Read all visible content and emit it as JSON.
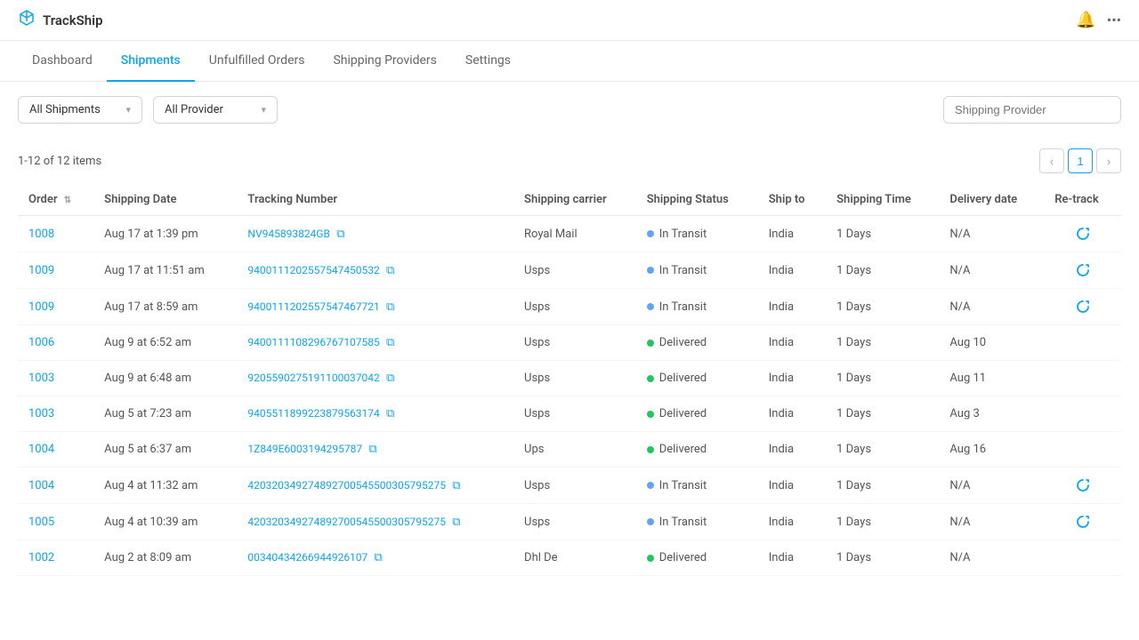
{
  "app": {
    "name": "TrackShip"
  },
  "nav": {
    "items": [
      {
        "label": "Dashboard",
        "active": false
      },
      {
        "label": "Shipments",
        "active": true
      },
      {
        "label": "Unfulfilled Orders",
        "active": false
      },
      {
        "label": "Shipping Providers",
        "active": false
      },
      {
        "label": "Settings",
        "active": false
      }
    ]
  },
  "toolbar": {
    "filter1_value": "All Shipments",
    "filter2_value": "All Provider",
    "search_placeholder": "Shipping Provider"
  },
  "table": {
    "pagination_text": "1-12 of 12 items",
    "current_page": "1",
    "columns": [
      "Order",
      "Shipping Date",
      "Tracking Number",
      "Shipping carrier",
      "Shipping Status",
      "Ship to",
      "Shipping Time",
      "Delivery date",
      "Re-track"
    ],
    "rows": [
      {
        "order": "1008",
        "date": "Aug 17 at 1:39 pm",
        "tracking": "NV945893824GB",
        "carrier": "Royal Mail",
        "status": "In Transit",
        "status_type": "transit",
        "ship_to": "India",
        "time": "1 Days",
        "delivery": "N/A",
        "retrack": true
      },
      {
        "order": "1009",
        "date": "Aug 17 at 11:51 am",
        "tracking": "9400111202557547450532",
        "carrier": "Usps",
        "status": "In Transit",
        "status_type": "transit",
        "ship_to": "India",
        "time": "1 Days",
        "delivery": "N/A",
        "retrack": true
      },
      {
        "order": "1009",
        "date": "Aug 17 at 8:59 am",
        "tracking": "9400111202557547467721",
        "carrier": "Usps",
        "status": "In Transit",
        "status_type": "transit",
        "ship_to": "India",
        "time": "1 Days",
        "delivery": "N/A",
        "retrack": true
      },
      {
        "order": "1006",
        "date": "Aug 9 at 6:52 am",
        "tracking": "9400111108296767107585",
        "carrier": "Usps",
        "status": "Delivered",
        "status_type": "delivered",
        "ship_to": "India",
        "time": "1 Days",
        "delivery": "Aug 10",
        "retrack": false
      },
      {
        "order": "1003",
        "date": "Aug 9 at 6:48 am",
        "tracking": "9205590275191100037042",
        "carrier": "Usps",
        "status": "Delivered",
        "status_type": "delivered",
        "ship_to": "India",
        "time": "1 Days",
        "delivery": "Aug 11",
        "retrack": false
      },
      {
        "order": "1003",
        "date": "Aug 5 at 7:23 am",
        "tracking": "9405511899223879563174",
        "carrier": "Usps",
        "status": "Delivered",
        "status_type": "delivered",
        "ship_to": "India",
        "time": "1 Days",
        "delivery": "Aug 3",
        "retrack": false
      },
      {
        "order": "1004",
        "date": "Aug 5 at 6:37 am",
        "tracking": "1Z849E6003194295787",
        "carrier": "Ups",
        "status": "Delivered",
        "status_type": "delivered",
        "ship_to": "India",
        "time": "1 Days",
        "delivery": "Aug 16",
        "retrack": false
      },
      {
        "order": "1004",
        "date": "Aug 4 at 11:32 am",
        "tracking": "420320349274892700545500305795275",
        "carrier": "Usps",
        "status": "In Transit",
        "status_type": "transit",
        "ship_to": "India",
        "time": "1 Days",
        "delivery": "N/A",
        "retrack": true
      },
      {
        "order": "1005",
        "date": "Aug 4 at 10:39 am",
        "tracking": "420320349274892700545500305795275",
        "carrier": "Usps",
        "status": "In Transit",
        "status_type": "transit",
        "ship_to": "India",
        "time": "1 Days",
        "delivery": "N/A",
        "retrack": true
      },
      {
        "order": "1002",
        "date": "Aug 2 at 8:09 am",
        "tracking": "00340434266944926107",
        "carrier": "Dhl De",
        "status": "Delivered",
        "status_type": "delivered",
        "ship_to": "India",
        "time": "1 Days",
        "delivery": "N/A",
        "retrack": false
      }
    ]
  }
}
